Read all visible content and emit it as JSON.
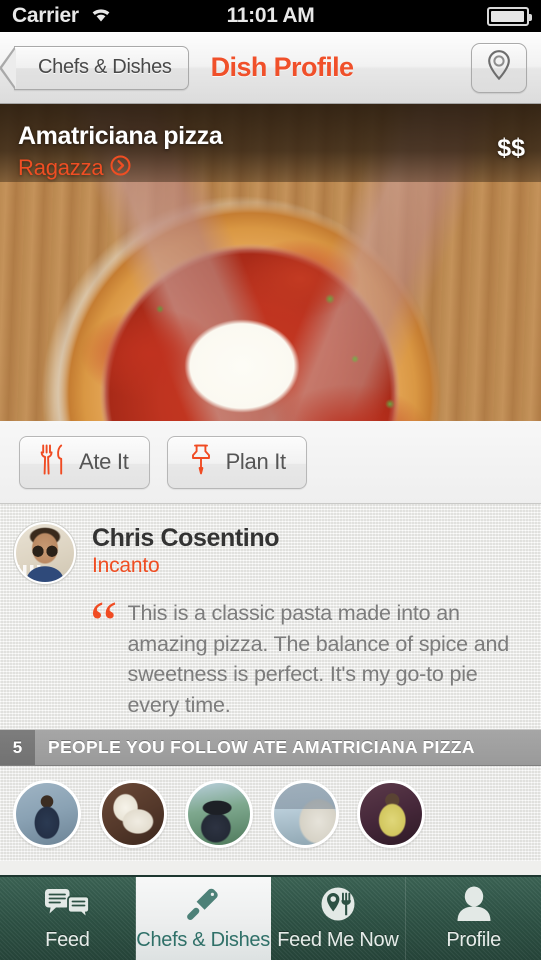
{
  "status_bar": {
    "carrier": "Carrier",
    "time": "11:01 AM",
    "wifi_icon": "wifi-icon",
    "battery_icon": "battery-icon"
  },
  "nav_bar": {
    "back_label": "Chefs & Dishes",
    "title": "Dish Profile",
    "map_icon": "map-pin-icon",
    "title_color": "#f0502a"
  },
  "hero": {
    "dish_name": "Amatriciana pizza",
    "restaurant": "Ragazza",
    "restaurant_disclosure_icon": "chevron-right-circle-icon",
    "price": "$$",
    "photo_alt": "amatriciana-pizza-with-egg-on-wooden-board"
  },
  "actions": [
    {
      "label": "Ate It",
      "icon": "fork-knife-icon"
    },
    {
      "label": "Plan It",
      "icon": "pushpin-icon"
    }
  ],
  "review": {
    "chef_name": "Chris Cosentino",
    "chef_restaurant": "Incanto",
    "chef_avatar_icon": "chef-avatar",
    "quote_icon": "quote-mark-icon",
    "text": "This is a classic pasta made into an amazing pizza. The balance of spice and sweetness is perfect. It's my go-to pie every time."
  },
  "followers": {
    "count": "5",
    "title": "PEOPLE YOU FOLLOW ATE AMATRICIANA PIZZA",
    "avatars": [
      "follower-avatar-1",
      "follower-avatar-2",
      "follower-avatar-3",
      "follower-avatar-4",
      "follower-avatar-5"
    ]
  },
  "tab_bar": {
    "tabs": [
      {
        "label": "Feed",
        "icon": "chat-bubbles-icon",
        "active": false
      },
      {
        "label": "Chefs & Dishes",
        "icon": "cleaver-icon",
        "active": true
      },
      {
        "label": "Feed Me Now",
        "icon": "pin-fork-icon",
        "active": false
      },
      {
        "label": "Profile",
        "icon": "person-icon",
        "active": false
      }
    ]
  },
  "colors": {
    "accent_orange": "#ef4e23",
    "tab_green": "#2d5144",
    "tab_active_text": "#2f7068",
    "linen_background": "#efefed"
  }
}
